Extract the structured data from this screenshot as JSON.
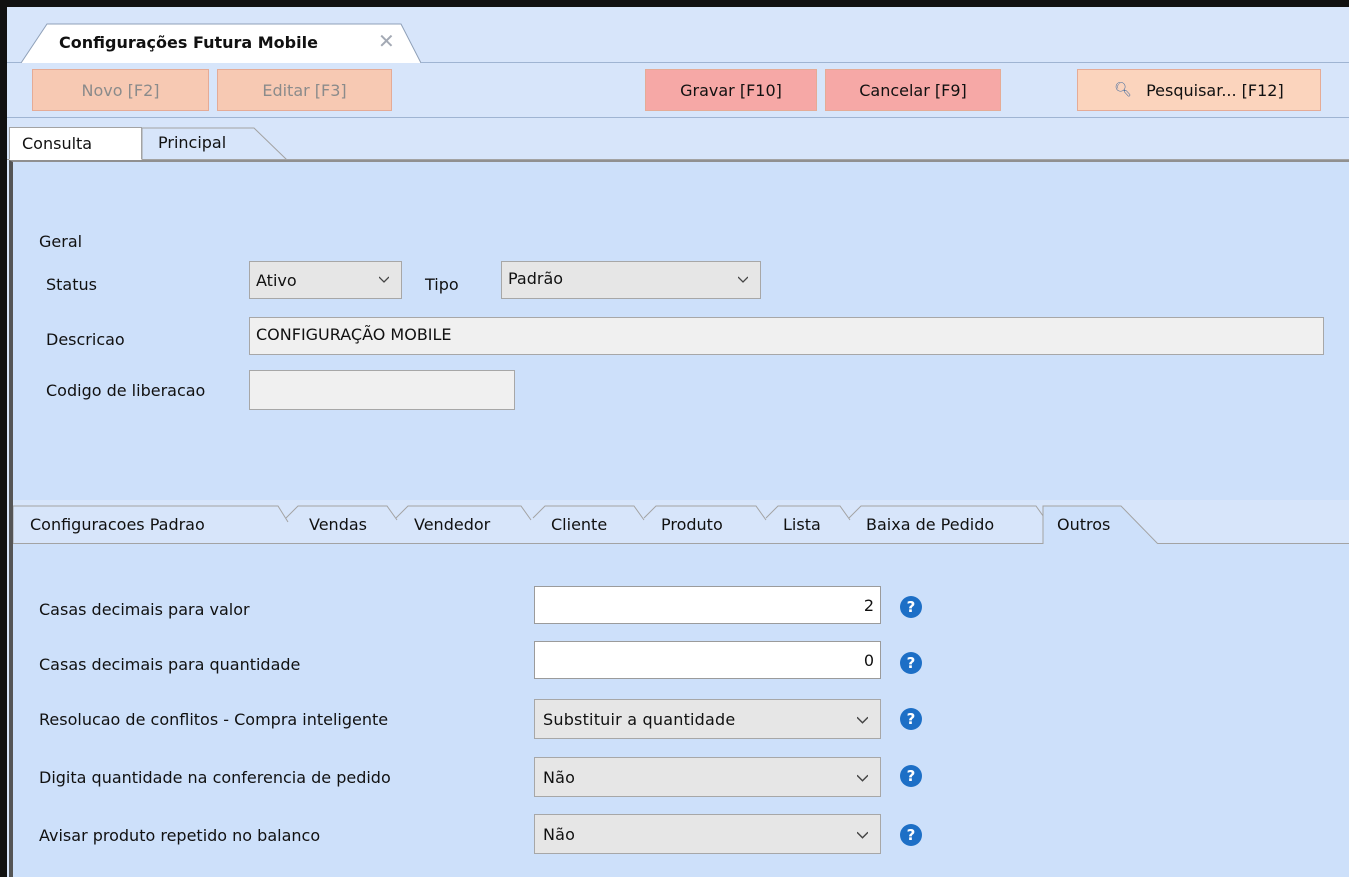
{
  "window": {
    "tab_title": "Configurações Futura Mobile",
    "close_glyph": "✕"
  },
  "toolbar": {
    "novo": "Novo [F2]",
    "editar": "Editar [F3]",
    "gravar": "Gravar [F10]",
    "cancelar": "Cancelar [F9]",
    "pesquisar": "Pesquisar... [F12]"
  },
  "main_tabs": [
    {
      "label": "Consulta",
      "active": true
    },
    {
      "label": "Principal",
      "active": false
    }
  ],
  "geral": {
    "section_label": "Geral",
    "status_label": "Status",
    "status_value": "Ativo",
    "tipo_label": "Tipo",
    "tipo_value": "Padrão",
    "descricao_label": "Descricao",
    "descricao_value": "CONFIGURAÇÃO MOBILE",
    "codigo_label": "Codigo de liberacao",
    "codigo_value": ""
  },
  "sub_tabs": [
    {
      "label": "Configuracoes Padrao"
    },
    {
      "label": "Vendas"
    },
    {
      "label": "Vendedor"
    },
    {
      "label": "Cliente"
    },
    {
      "label": "Produto"
    },
    {
      "label": "Lista"
    },
    {
      "label": "Baixa de Pedido"
    },
    {
      "label": "Outros",
      "active": true
    }
  ],
  "outros": {
    "casas_valor_label": "Casas decimais para valor",
    "casas_valor_value": "2",
    "casas_qtd_label": "Casas decimais para quantidade",
    "casas_qtd_value": "0",
    "conflitos_label": "Resolucao de conflitos - Compra inteligente",
    "conflitos_value": "Substituir a quantidade",
    "digita_label": "Digita quantidade na conferencia de pedido",
    "digita_value": "Não",
    "avisar_label": "Avisar produto repetido no balanco",
    "avisar_value": "Não"
  },
  "help_glyph": "?",
  "colors": {
    "background": "#d7e5fa",
    "panel": "#cde0fa",
    "primary_button": "#f6a8a6",
    "disabled_button": "#f7c9b3",
    "help_icon": "#1d6fc6"
  }
}
